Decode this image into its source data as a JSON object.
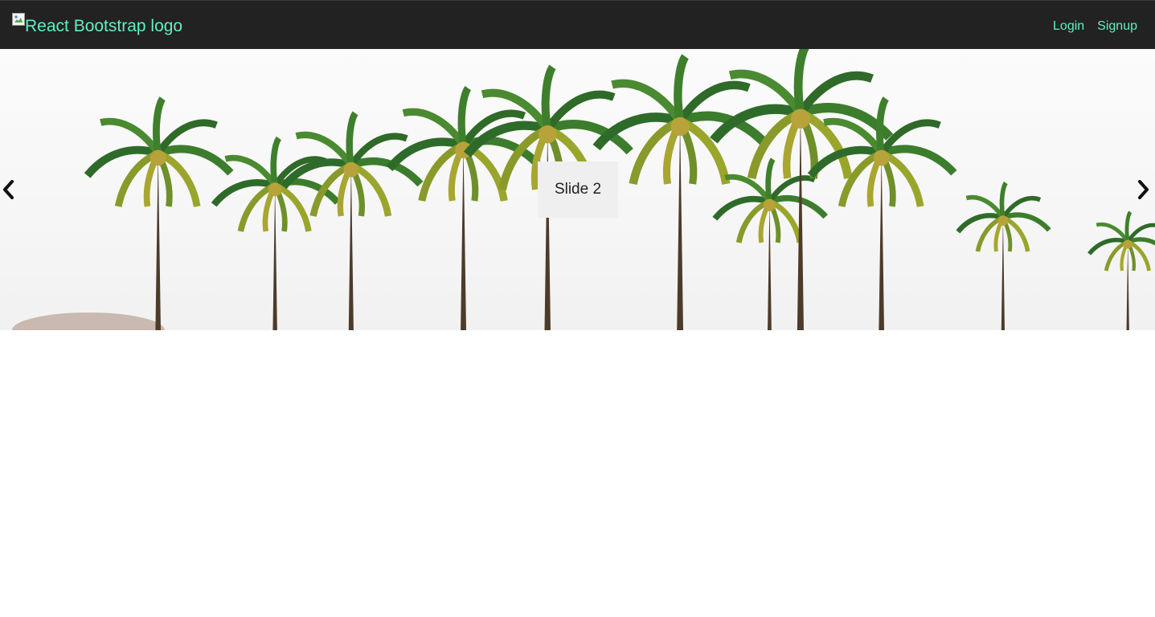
{
  "navbar": {
    "brand_alt": "React Bootstrap logo",
    "links": [
      {
        "label": "Login"
      },
      {
        "label": "Signup"
      }
    ],
    "accent_color": "#5ef0c3",
    "background": "#222222"
  },
  "carousel": {
    "active_caption": "Slide 2",
    "prev_icon": "chevron-left-icon",
    "next_icon": "chevron-right-icon",
    "image_subject": "palm-trees"
  }
}
